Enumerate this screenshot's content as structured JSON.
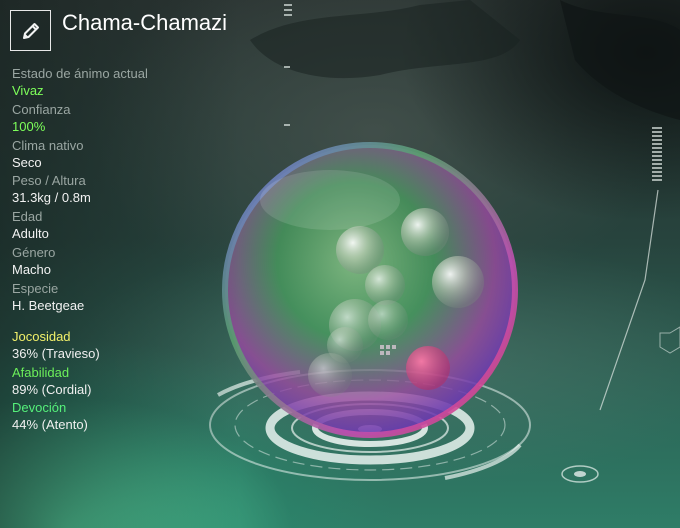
{
  "creature": {
    "name": "Chama-Chamazi"
  },
  "stats": [
    {
      "label": "Estado de ánimo actual",
      "value": "Vivaz",
      "highlight": true
    },
    {
      "label": "Confianza",
      "value": "100%",
      "highlight": true
    },
    {
      "label": "Clima nativo",
      "value": "Seco",
      "highlight": false
    },
    {
      "label": "Peso / Altura",
      "value": "31.3kg / 0.8m",
      "highlight": false
    },
    {
      "label": "Edad",
      "value": "Adulto",
      "highlight": false
    },
    {
      "label": "Género",
      "value": "Macho",
      "highlight": false
    },
    {
      "label": "Especie",
      "value": "H. Beetgeae",
      "highlight": false
    }
  ],
  "traits": [
    {
      "label": "Jocosidad",
      "value": "36% (Travieso)",
      "color": "#f2f06a"
    },
    {
      "label": "Afabilidad",
      "value": "89% (Cordial)",
      "color": "#6cf05a"
    },
    {
      "label": "Devoción",
      "value": "44% (Atento)",
      "color": "#55f07a"
    }
  ],
  "icons": {
    "edit": "pencil-icon"
  }
}
